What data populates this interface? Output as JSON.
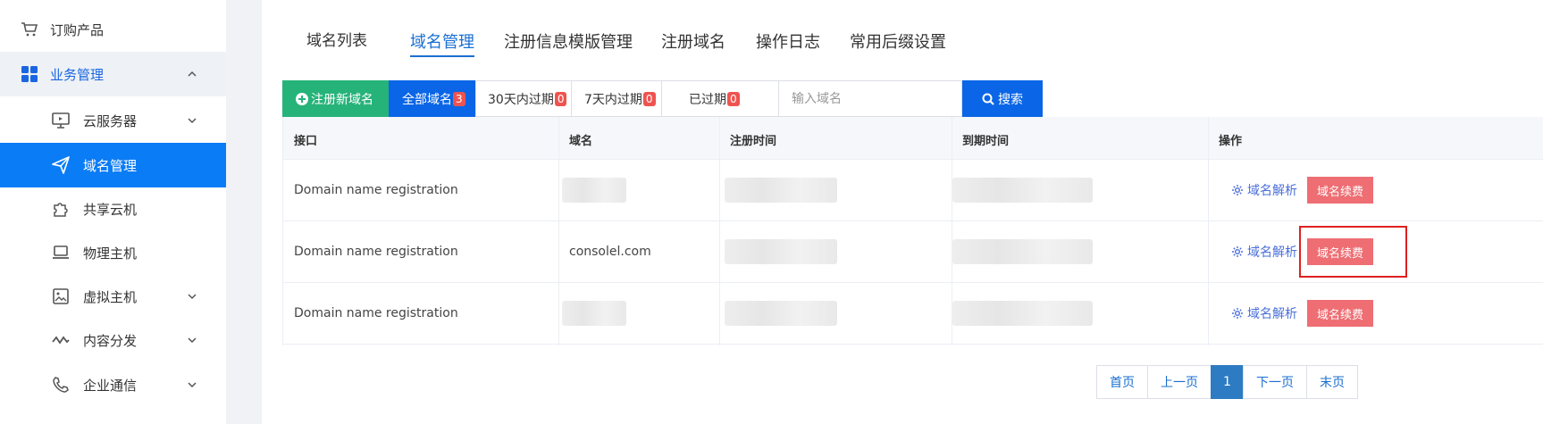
{
  "sidebar": {
    "items": [
      {
        "label": "订购产品",
        "icon": "cart-icon"
      },
      {
        "label": "业务管理",
        "icon": "grid-icon",
        "chevron": "up"
      },
      {
        "label": "云服务器",
        "icon": "monitor-icon",
        "chevron": "down"
      },
      {
        "label": "域名管理",
        "icon": "paper-plane-icon"
      },
      {
        "label": "共享云机",
        "icon": "puzzle-icon"
      },
      {
        "label": "物理主机",
        "icon": "laptop-icon"
      },
      {
        "label": "虚拟主机",
        "icon": "image-icon",
        "chevron": "down"
      },
      {
        "label": "内容分发",
        "icon": "wave-icon",
        "chevron": "down"
      },
      {
        "label": "企业通信",
        "icon": "phone-icon",
        "chevron": "down"
      }
    ]
  },
  "tabs": {
    "title": "域名列表",
    "items": [
      "域名管理",
      "注册信息模版管理",
      "注册域名",
      "操作日志",
      "常用后缀设置"
    ]
  },
  "filters": {
    "register_new": "注册新域名",
    "all": {
      "label": "全部域名",
      "count": "3"
    },
    "in30": {
      "label": "30天内过期",
      "count": "0"
    },
    "in7": {
      "label": "7天内过期",
      "count": "0"
    },
    "expired": {
      "label": "已过期",
      "count": "0"
    },
    "search_placeholder": "输入域名",
    "search_button": "搜索"
  },
  "table": {
    "headers": [
      "接口",
      "域名",
      "注册时间",
      "到期时间",
      "操作"
    ],
    "rows": [
      {
        "interface": "Domain name registration",
        "domain": ""
      },
      {
        "interface": "Domain name registration",
        "domain": "consolel.com"
      },
      {
        "interface": "Domain name registration",
        "domain": ""
      }
    ],
    "action_resolve": "域名解析",
    "action_renew": "域名续费"
  },
  "pagination": {
    "first": "首页",
    "prev": "上一页",
    "current": "1",
    "next": "下一页",
    "last": "末页"
  },
  "colors": {
    "active_sidebar": "#0a7cf6",
    "primary": "#0a66e6",
    "success": "#26b37a",
    "danger": "#ee6e73"
  }
}
